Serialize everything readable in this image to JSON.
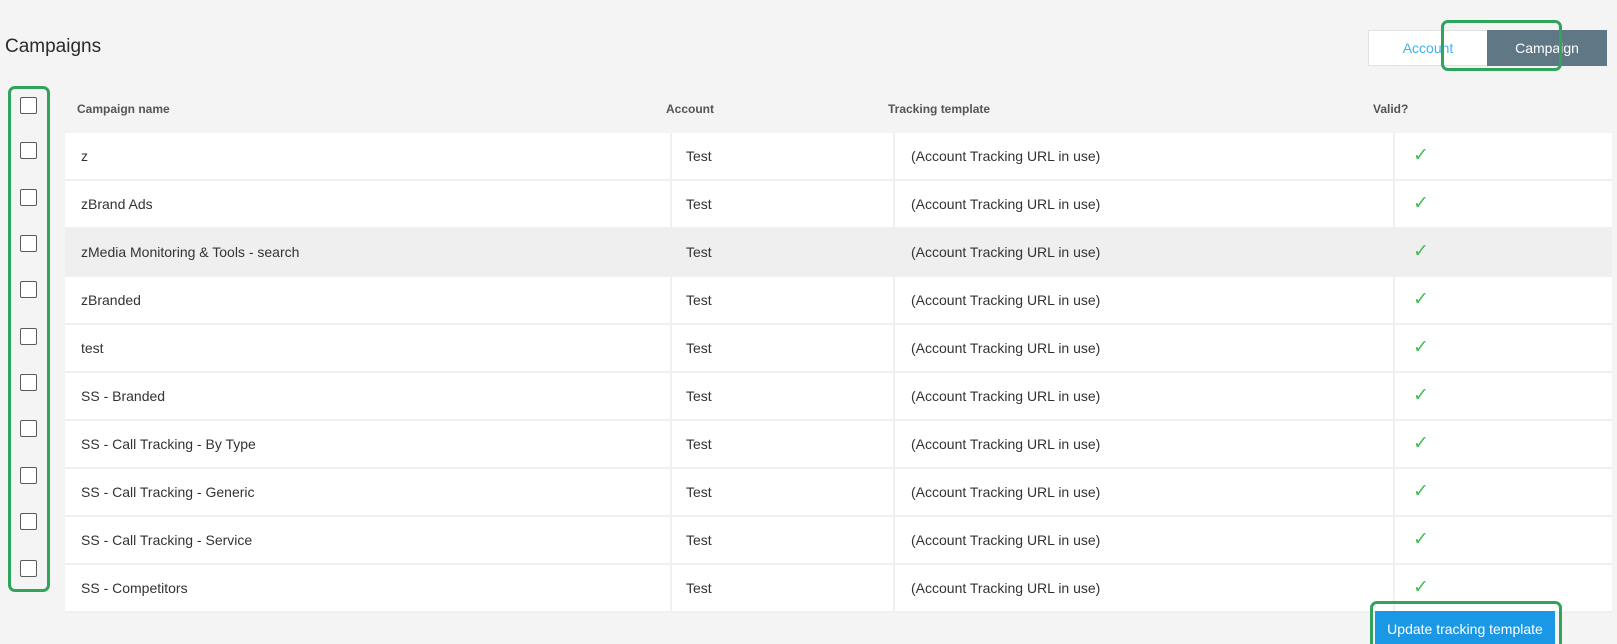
{
  "page": {
    "title": "Campaigns"
  },
  "toggle": {
    "account_label": "Account",
    "campaign_label": "Campaign",
    "selected": "Campaign"
  },
  "table": {
    "headers": {
      "name": "Campaign name",
      "account": "Account",
      "template": "Tracking template",
      "valid": "Valid?"
    },
    "rows": [
      {
        "name": "z",
        "account": "Test",
        "template": "(Account Tracking URL in use)",
        "valid": "✓"
      },
      {
        "name": "zBrand Ads",
        "account": "Test",
        "template": "(Account Tracking URL in use)",
        "valid": "✓"
      },
      {
        "name": "zMedia Monitoring & Tools - search",
        "account": "Test",
        "template": "(Account Tracking URL in use)",
        "valid": "✓"
      },
      {
        "name": "zBranded",
        "account": "Test",
        "template": "(Account Tracking URL in use)",
        "valid": "✓"
      },
      {
        "name": "test",
        "account": "Test",
        "template": "(Account Tracking URL in use)",
        "valid": "✓"
      },
      {
        "name": "SS - Branded",
        "account": "Test",
        "template": "(Account Tracking URL in use)",
        "valid": "✓"
      },
      {
        "name": "SS - Call Tracking - By Type",
        "account": "Test",
        "template": "(Account Tracking URL in use)",
        "valid": "✓"
      },
      {
        "name": "SS - Call Tracking - Generic",
        "account": "Test",
        "template": "(Account Tracking URL in use)",
        "valid": "✓"
      },
      {
        "name": "SS - Call Tracking - Service",
        "account": "Test",
        "template": "(Account Tracking URL in use)",
        "valid": "✓"
      },
      {
        "name": "SS - Competitors",
        "account": "Test",
        "template": "(Account Tracking URL in use)",
        "valid": "✓"
      }
    ]
  },
  "actions": {
    "update_label": "Update tracking template"
  },
  "colors": {
    "accent": "#1a98e6",
    "selected_toggle": "#607886",
    "valid_check": "#3fbf4f",
    "annotation": "#2fa45a"
  }
}
